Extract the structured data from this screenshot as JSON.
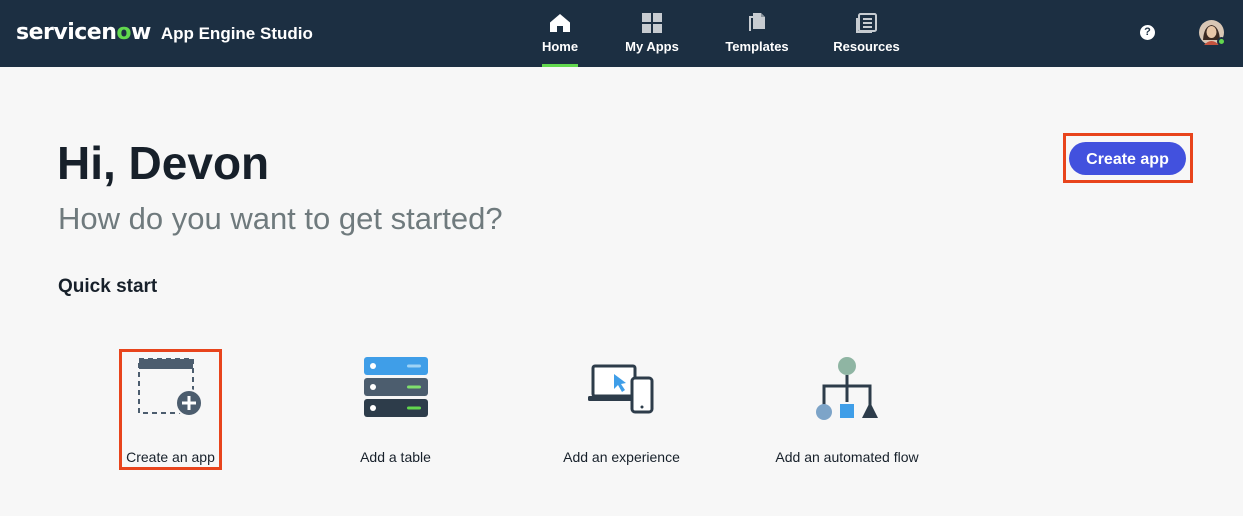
{
  "header": {
    "logo_pre": "servicen",
    "logo_accent": "o",
    "logo_post": "w",
    "product_name": "App Engine Studio",
    "nav": [
      {
        "label": "Home",
        "icon": "home-icon",
        "active": true
      },
      {
        "label": "My Apps",
        "icon": "grid-icon",
        "active": false
      },
      {
        "label": "Templates",
        "icon": "templates-icon",
        "active": false
      },
      {
        "label": "Resources",
        "icon": "resources-icon",
        "active": false
      }
    ],
    "help_label": "?",
    "avatar_icon": "user-avatar"
  },
  "main": {
    "greeting": "Hi, Devon",
    "subtitle": "How do you want to get started?",
    "create_app_label": "Create app",
    "quick_start_title": "Quick start",
    "quick_start": [
      {
        "label": "Create an app",
        "icon": "create-app-icon"
      },
      {
        "label": "Add a table",
        "icon": "table-icon"
      },
      {
        "label": "Add an experience",
        "icon": "devices-icon"
      },
      {
        "label": "Add an automated flow",
        "icon": "flow-icon"
      }
    ]
  },
  "colors": {
    "header_bg": "#1c2f42",
    "brand_green": "#62d84e",
    "primary_button": "#4251de",
    "highlight": "#e8441c",
    "page_bg": "#f7f7f7"
  }
}
